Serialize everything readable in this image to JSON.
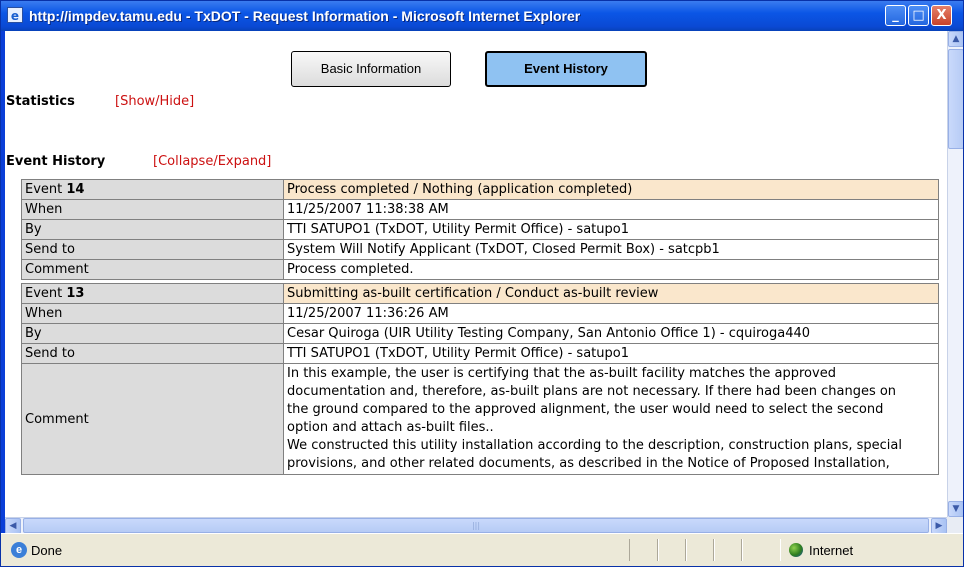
{
  "window": {
    "title": "http://impdev.tamu.edu - TxDOT - Request Information - Microsoft Internet Explorer",
    "controls": {
      "minimize": "_",
      "maximize": "□",
      "close": "X"
    }
  },
  "tabs": [
    {
      "label": "Basic Information",
      "active": false
    },
    {
      "label": "Event History",
      "active": true
    }
  ],
  "statistics": {
    "title": "Statistics",
    "toggle": "[Show/Hide]"
  },
  "event_history": {
    "title": "Event History",
    "toggle": "[Collapse/Expand]",
    "events": [
      {
        "label": "Event",
        "number": "14",
        "summary": "Process completed / Nothing (application completed)",
        "when_label": "When",
        "when": "11/25/2007 11:38:38 AM",
        "by_label": "By",
        "by": "TTI SATUPO1 (TxDOT, Utility Permit Office) - satupo1",
        "send_label": "Send to",
        "send_to": "System Will Notify Applicant (TxDOT, Closed Permit Box) - satcpb1",
        "comment_label": "Comment",
        "comment": "Process completed."
      },
      {
        "label": "Event",
        "number": "13",
        "summary": "Submitting as-built certification / Conduct as-built review",
        "when_label": "When",
        "when": "11/25/2007 11:36:26 AM",
        "by_label": "By",
        "by": "Cesar Quiroga (UIR Utility Testing Company, San Antonio Office 1) - cquiroga440",
        "send_label": "Send to",
        "send_to": "TTI SATUPO1 (TxDOT, Utility Permit Office) - satupo1",
        "comment_label": "Comment",
        "comment_lines": [
          "In this example, the user is certifying that the as-built facility matches the approved",
          "documentation and, therefore, as-built plans are not necessary. If there had been changes on",
          "the ground compared to the approved alignment, the user would need to select the second",
          "option and attach as-built files..",
          "We constructed this utility installation according to the description, construction plans, special",
          "provisions, and other related documents, as described in the Notice of Proposed Installation,"
        ]
      }
    ]
  },
  "status_bar": {
    "text": "Done",
    "zone": "Internet"
  }
}
